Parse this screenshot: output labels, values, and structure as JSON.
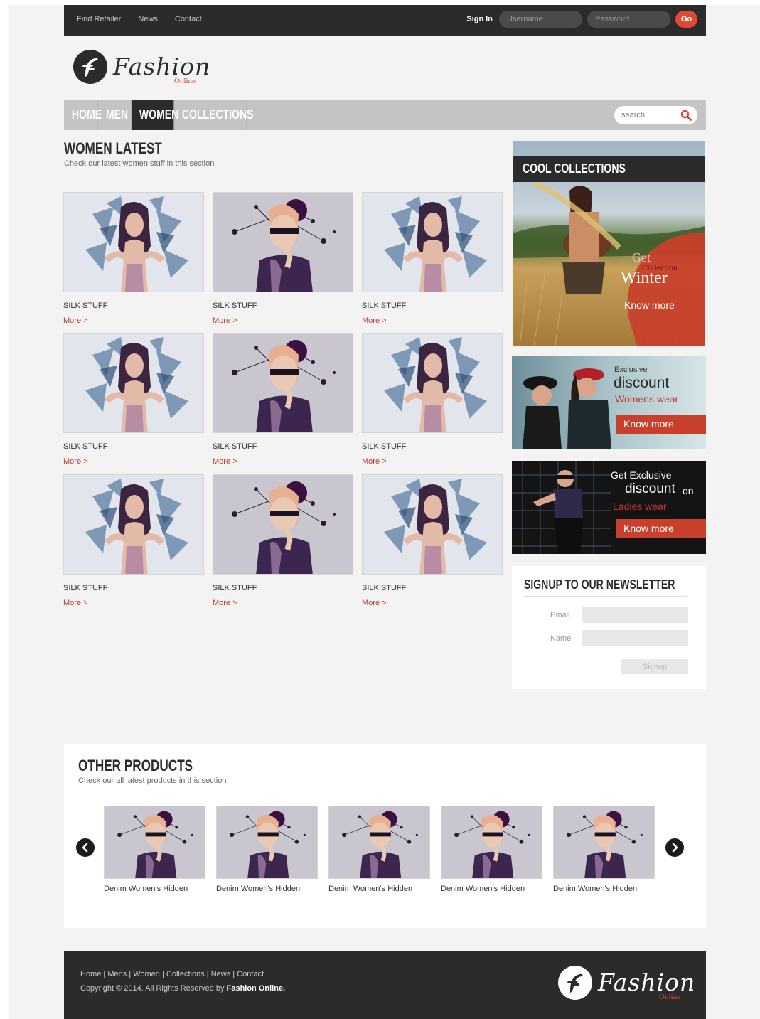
{
  "topbar": {
    "links": [
      "Find Retailer",
      "News",
      "Contact"
    ],
    "signin_label": "Sign In",
    "username_placeholder": "Username",
    "password_placeholder": "Password",
    "go_label": "Go"
  },
  "brand": {
    "name": "Fashion",
    "sub": "Online"
  },
  "mainnav": {
    "items": [
      "HOME",
      "MEN",
      "WOMEN",
      "COLLECTIONS"
    ],
    "active": "WOMEN",
    "search_placeholder": "search"
  },
  "latest": {
    "title": "WOMEN LATEST",
    "subtitle": "Check our latest women stuff in this section",
    "items": [
      {
        "title": "SILK STUFF",
        "more": "More >"
      },
      {
        "title": "SILK STUFF",
        "more": "More >"
      },
      {
        "title": "SILK STUFF",
        "more": "More >"
      },
      {
        "title": "SILK STUFF",
        "more": "More >"
      },
      {
        "title": "SILK STUFF",
        "more": "More >"
      },
      {
        "title": "SILK STUFF",
        "more": "More >"
      },
      {
        "title": "SILK STUFF",
        "more": "More >"
      },
      {
        "title": "SILK STUFF",
        "more": "More >"
      },
      {
        "title": "SILK STUFF",
        "more": "More >"
      }
    ]
  },
  "sidebar": {
    "cool": {
      "title": "COOL COLLECTIONS",
      "get": "Get",
      "collection": "Collection",
      "season": "Winter",
      "cta": "Know more"
    },
    "discount1": {
      "exclusive": "Exclusive",
      "discount": "discount",
      "target": "Womens wear",
      "cta": "Know more"
    },
    "discount2": {
      "line1": "Get Exclusive",
      "discount": "discount",
      "on": "on",
      "target": "Ladies wear",
      "cta": "Know more"
    },
    "newsletter": {
      "title": "SIGNUP TO OUR NEWSLETTER",
      "email_label": "Email",
      "name_label": "Name",
      "button": "Signup"
    }
  },
  "other": {
    "title": "OTHER PRODUCTS",
    "subtitle": "Check our all latest products in this section",
    "products": [
      {
        "name": "Denim Women's Hidden"
      },
      {
        "name": "Denim Women's Hidden"
      },
      {
        "name": "Denim Women's Hidden"
      },
      {
        "name": "Denim Women's Hidden"
      },
      {
        "name": "Denim Women's Hidden"
      }
    ]
  },
  "footer": {
    "links": [
      "Home",
      "Mens",
      "Women",
      "Collections",
      "News",
      "Contact"
    ],
    "copyright_prefix": "Copyright © 2014. All Rights Reserved by",
    "copyright_brand": "Fashion Online."
  },
  "colors": {
    "accent": "#e04a35",
    "dark": "#2b2b2b",
    "nav_gray": "#c4c4c4",
    "link_red": "#c0392b"
  }
}
